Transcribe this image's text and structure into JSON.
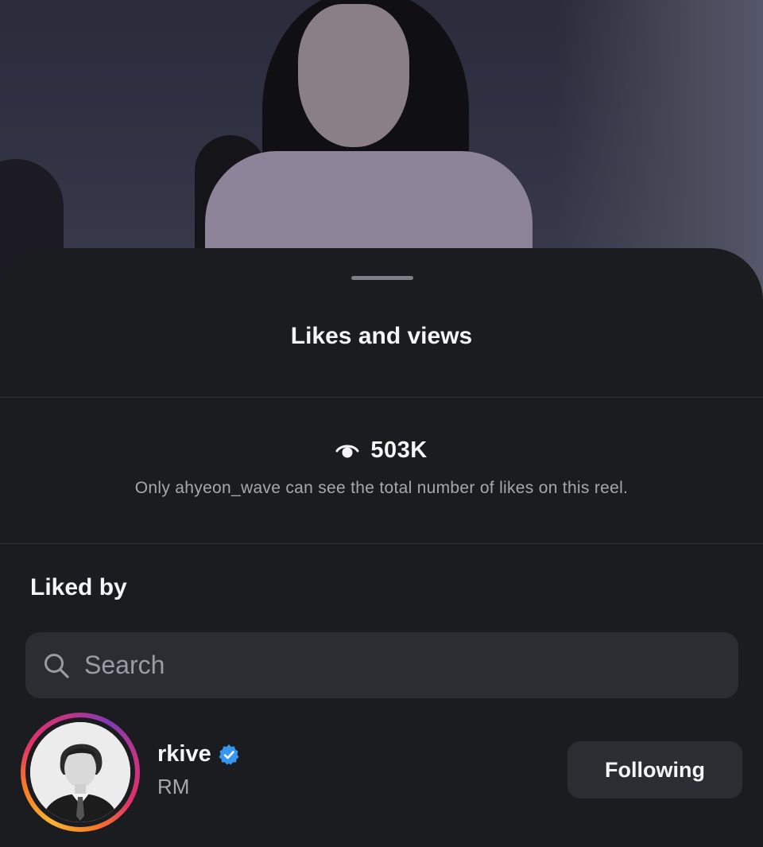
{
  "sheet": {
    "title": "Likes and views"
  },
  "views": {
    "icon": "eye-icon",
    "count": "503K",
    "note": "Only ahyeon_wave can see the total number of likes on this reel."
  },
  "liked_by": {
    "label": "Liked by",
    "search": {
      "placeholder": "Search",
      "value": "",
      "icon": "search-icon"
    },
    "users": [
      {
        "username": "rkive",
        "full_name": "RM",
        "verified": true,
        "follow_label": "Following"
      }
    ]
  },
  "colors": {
    "sheet_background": "#1b1c20",
    "input_background": "#2c2d33",
    "verified_blue": "#3797f0",
    "secondary_text": "#a6a8ae"
  }
}
